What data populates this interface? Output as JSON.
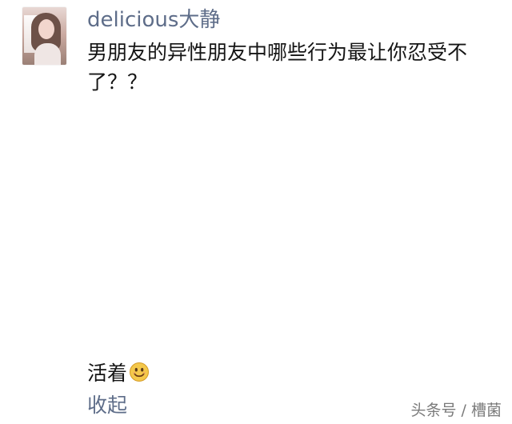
{
  "post": {
    "username": "delicious大静",
    "content": "男朋友的异性朋友中哪些行为最让你忍受不了？？",
    "reply": {
      "text": "活着",
      "emoji_icon": "smiley-icon"
    },
    "collapse_label": "收起"
  },
  "watermark": "头条号 / 槽菌",
  "colors": {
    "username": "#5e6d89",
    "text": "#151515",
    "background": "#ffffff",
    "watermark": "#7a7a7a"
  }
}
